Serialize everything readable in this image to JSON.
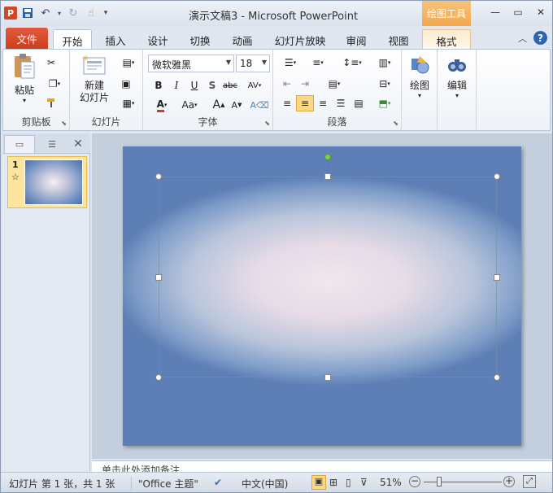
{
  "window": {
    "title": "演示文稿3 - Microsoft PowerPoint",
    "context_tab_group": "绘图工具",
    "min_icon": "minimize-icon",
    "max_icon": "restore-icon",
    "close_icon": "close-icon"
  },
  "qat": {
    "app_letter": "P"
  },
  "tabs": {
    "file": "文件",
    "home": "开始",
    "insert": "插入",
    "design": "设计",
    "transitions": "切换",
    "animations": "动画",
    "slideshow": "幻灯片放映",
    "review": "审阅",
    "view": "视图",
    "format": "格式"
  },
  "ribbon": {
    "clipboard": {
      "label": "剪贴板",
      "paste": "粘贴"
    },
    "slides": {
      "label": "幻灯片",
      "new_slide": "新建\n幻灯片"
    },
    "font": {
      "label": "字体",
      "font_name": "微软雅黑",
      "font_size": "18"
    },
    "paragraph": {
      "label": "段落"
    },
    "drawing": {
      "label": "绘图"
    },
    "editing": {
      "label": "编辑"
    }
  },
  "panel": {
    "slide_number": "1",
    "star": "☆"
  },
  "notes": {
    "placeholder": "单击此处添加备注"
  },
  "status": {
    "slide_info": "幻灯片 第 1 张，共 1 张",
    "theme": "\"Office 主题\"",
    "language": "中文(中国)",
    "zoom": "51%"
  }
}
